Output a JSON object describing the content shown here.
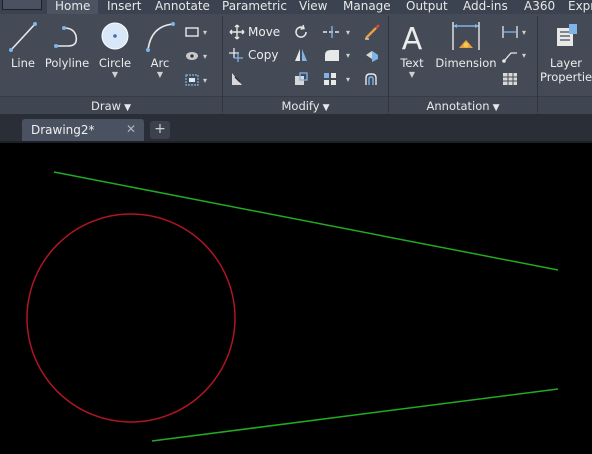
{
  "ribbon_tabs": [
    "Home",
    "Insert",
    "Annotate",
    "Parametric",
    "View",
    "Manage",
    "Output",
    "Add-ins",
    "A360",
    "Expr"
  ],
  "draw_panel": {
    "title": "Draw",
    "line": "Line",
    "polyline": "Polyline",
    "circle": "Circle",
    "arc": "Arc"
  },
  "modify_panel": {
    "title": "Modify",
    "move": "Move",
    "copy": "Copy"
  },
  "annotation_panel": {
    "title": "Annotation",
    "text": "Text",
    "dimension": "Dimension"
  },
  "layers_panel": {
    "layer_properties_line1": "Layer",
    "layer_properties_line2": "Properties"
  },
  "document_tab": {
    "label": "Drawing2*",
    "close": "✕",
    "new": "+"
  },
  "colors": {
    "line_color": "#22aa22",
    "circle_color": "#b01522",
    "canvas_bg": "#000000"
  }
}
